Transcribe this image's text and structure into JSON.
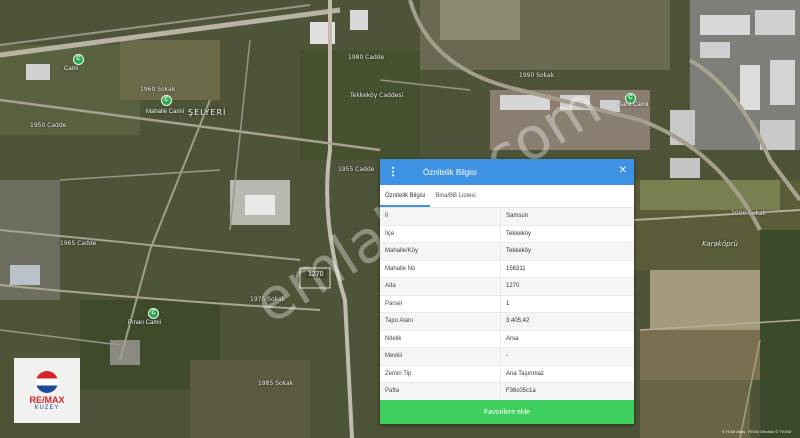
{
  "map": {
    "district_label": "ŞELYERİ",
    "place_label": "Karaköprü",
    "parcel_tag": "1270",
    "street_labels": [
      "1960 Sokak",
      "1980 Cadde",
      "1950 Cadde",
      "Tekkeköy Caddesi",
      "1990 Sokak",
      "1955 Cadde",
      "1965 Cadde",
      "1975 Sokak",
      "1985 Sokak",
      "2000 Sokak"
    ],
    "pois": [
      {
        "icon": "mosque-icon",
        "label": "Cami"
      },
      {
        "icon": "mosque-icon",
        "label": "Mahalle Camii"
      },
      {
        "icon": "mosque-icon",
        "label": "Pınarı Camii"
      },
      {
        "icon": "mosque-icon",
        "label": "Sahil Camii"
      }
    ],
    "watermark": "emlakjet.com",
    "attribution": "© HGM Atlas, TKGM Ortofoto © TKGM"
  },
  "panel": {
    "title": "Öznitelik Bilgisi",
    "tabs": [
      {
        "label": "Öznitelik Bilgisi",
        "active": true
      },
      {
        "label": "Bina/BB Listesi",
        "active": false
      }
    ],
    "rows": [
      {
        "key": "İl",
        "value": "Samsun"
      },
      {
        "key": "İlçe",
        "value": "Tekkeköy"
      },
      {
        "key": "Mahalle/Köy",
        "value": "Tekkeköy"
      },
      {
        "key": "Mahalle No",
        "value": "156311"
      },
      {
        "key": "Ada",
        "value": "1270"
      },
      {
        "key": "Parsel",
        "value": "1"
      },
      {
        "key": "Tapu Alanı",
        "value": "3.405,42"
      },
      {
        "key": "Nitelik",
        "value": "Arsa"
      },
      {
        "key": "Mevkii",
        "value": "-"
      },
      {
        "key": "Zemin Tip",
        "value": "Ana Taşınmaz"
      },
      {
        "key": "Pafta",
        "value": "F36c05c1a"
      }
    ],
    "favorite_button": "Favorilere ekle"
  },
  "logo": {
    "brand": "RE/MAX",
    "sub": "KUZEY"
  },
  "colors": {
    "header": "#3d92e4",
    "button": "#3fcf5e",
    "poi": "#2fa84f"
  }
}
